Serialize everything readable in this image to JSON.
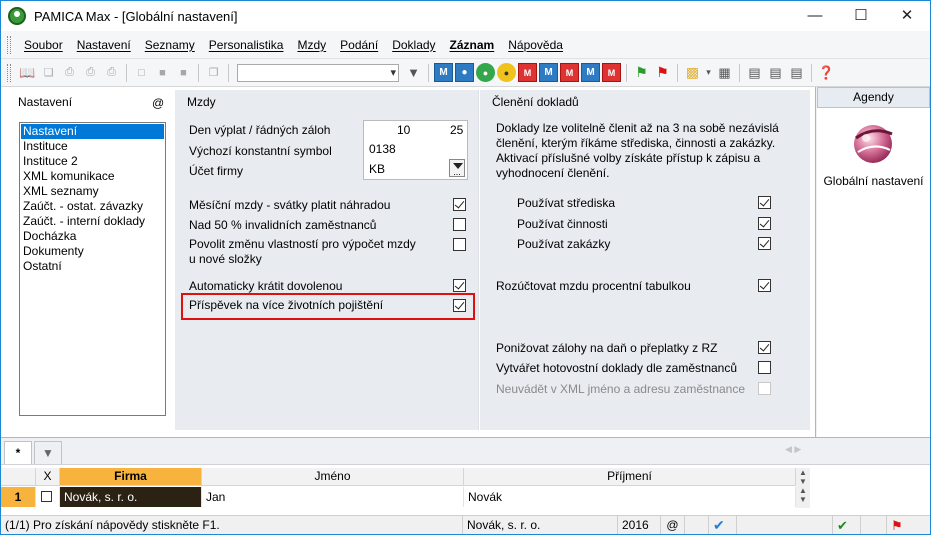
{
  "window": {
    "title": "PAMICA Max - [Globální nastavení]"
  },
  "menu": [
    "Soubor",
    "Nastavení",
    "Seznamy",
    "Personalistika",
    "Mzdy",
    "Podání",
    "Doklady",
    "Záznam",
    "Nápověda"
  ],
  "toolbar": {
    "combo_value": ""
  },
  "nastaveni": {
    "title": "Nastavení",
    "at_symbol": "@",
    "items": [
      "Nastavení",
      "Instituce",
      "Instituce 2",
      "XML komunikace",
      "XML seznamy",
      "Zaúčt. - ostat. závazky",
      "Zaúčt. - interní doklady",
      "Docházka",
      "Dokumenty",
      "Ostatní"
    ],
    "selected_index": 0
  },
  "mzdy": {
    "title": "Mzdy",
    "den_vyplat_label": "Den výplat / řádných záloh",
    "den_vyplat_value": "10",
    "zaloh_value": "25",
    "konst_symbol_label": "Výchozí konstantní symbol",
    "konst_symbol_value": "0138",
    "ucet_firmy_label": "Účet firmy",
    "ucet_firmy_value": "KB",
    "dots": "...",
    "options": [
      {
        "label": "Měsíční mzdy - svátky platit náhradou",
        "checked": true
      },
      {
        "label": "Nad 50 % invalidních zaměstnanců",
        "checked": false
      },
      {
        "label": "Povolit změnu vlastností pro výpočet mzdy",
        "label2": "u nové složky",
        "checked": false
      },
      {
        "label": "Automaticky krátit dovolenou",
        "checked": true
      },
      {
        "label": "Příspěvek na více životních pojištění",
        "checked": true
      }
    ]
  },
  "cleneni": {
    "title": "Členění dokladů",
    "description": "Doklady lze volitelně členit až na 3 na sobě nezávislá členění, kterým říkáme střediska, činnosti a zakázky. Aktivací příslušné volby získáte přístup k zápisu a vyhodnocení členění.",
    "options": [
      {
        "label": "Používat střediska",
        "checked": true
      },
      {
        "label": "Používat činnosti",
        "checked": true
      },
      {
        "label": "Používat zakázky",
        "checked": true
      }
    ],
    "rozuctovat": {
      "label": "Rozúčtovat mzdu procentní tabulkou",
      "checked": true
    },
    "extra": [
      {
        "label": "Ponižovat zálohy na daň o přeplatky z RZ",
        "checked": true,
        "disabled": false
      },
      {
        "label": "Vytvářet hotovostní doklady dle zaměstnanců",
        "checked": false,
        "disabled": false
      },
      {
        "label": "Neuvádět v XML jméno a adresu zaměstnance",
        "checked": false,
        "disabled": true
      }
    ]
  },
  "agendy": {
    "title": "Agendy",
    "item_label": "Globální nastavení"
  },
  "grid": {
    "tab_star": "*",
    "columns": [
      "X",
      "Firma",
      "Jméno",
      "Příjmení"
    ],
    "row": {
      "num": "1",
      "firma": "Novák, s. r. o.",
      "jmeno": "Jan",
      "prijmeni": "Novák"
    }
  },
  "status": {
    "help": "(1/1) Pro získání nápovědy stiskněte F1.",
    "company": "Novák, s. r. o.",
    "year": "2016",
    "at": "@"
  }
}
